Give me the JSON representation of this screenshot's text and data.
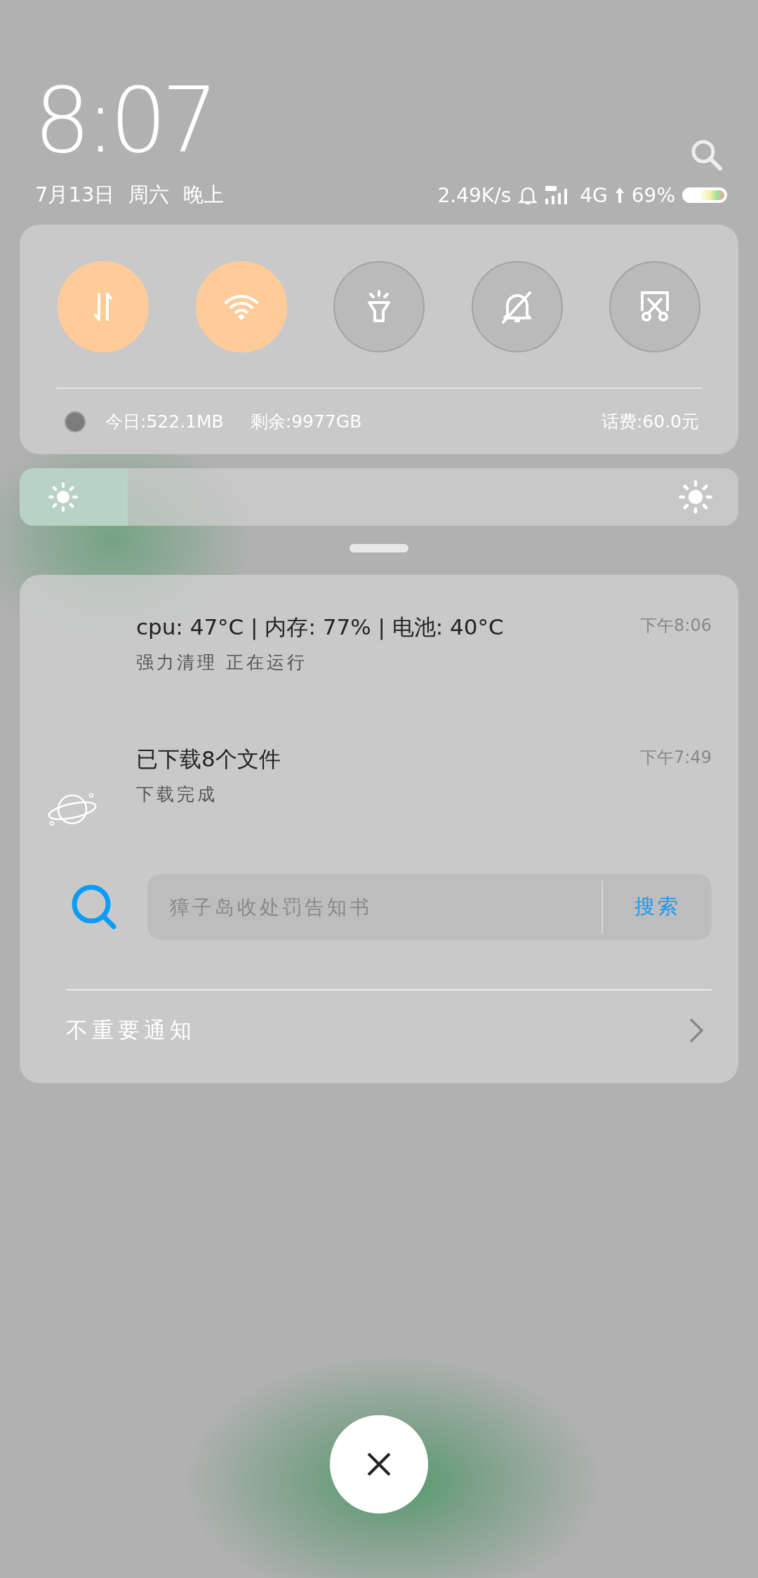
{
  "header": {
    "time": "8:07",
    "date": "7月13日",
    "weekday": "周六",
    "period": "晚上",
    "net_speed": "2.49K/s",
    "network_type": "4G",
    "battery_percent": "69%"
  },
  "quick_settings": {
    "toggles": [
      {
        "kind": "data",
        "on": true
      },
      {
        "kind": "wifi",
        "on": true
      },
      {
        "kind": "flashlight",
        "on": false
      },
      {
        "kind": "mute",
        "on": false
      },
      {
        "kind": "screenshot",
        "on": false
      }
    ],
    "today_usage": "今日:522.1MB",
    "remaining": "剩余:9977GB",
    "balance": "话费:60.0元"
  },
  "brightness": {
    "level": 0.15
  },
  "notifications": [
    {
      "kind": "blank",
      "title": "cpu: 47°C | 内存: 77% | 电池: 40°C",
      "subtitle": "强力清理 正在运行",
      "time": "下午8:06"
    },
    {
      "kind": "planet",
      "title": "已下载8个文件",
      "subtitle": "下载完成",
      "time": "下午7:49"
    }
  ],
  "search": {
    "placeholder": "獐子岛收处罚告知书",
    "button": "搜索"
  },
  "unimportant": {
    "label": "不重要通知"
  }
}
